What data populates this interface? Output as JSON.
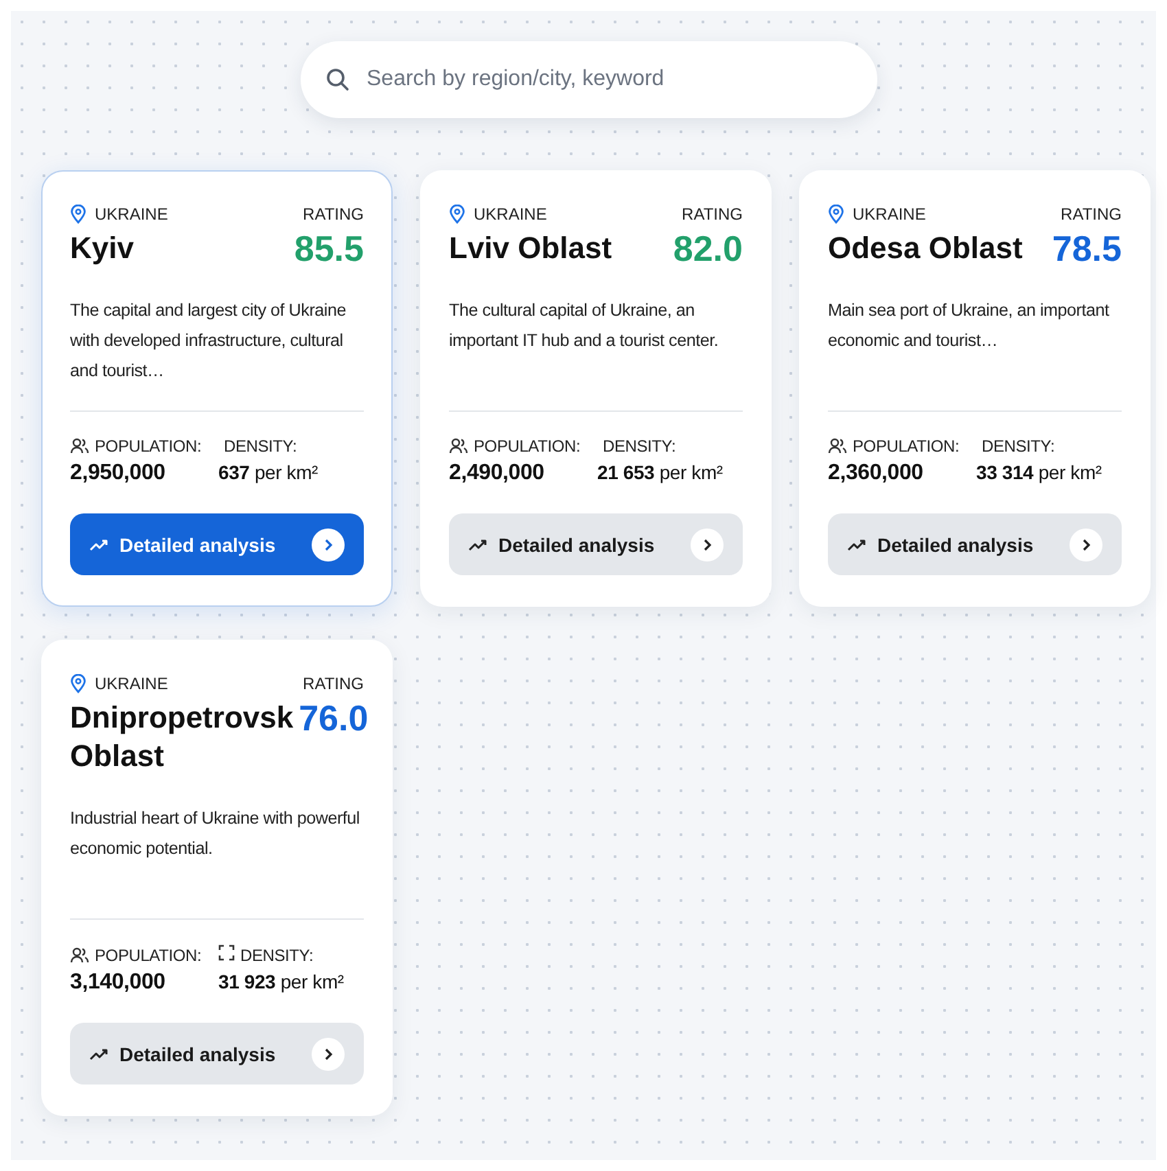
{
  "search": {
    "placeholder": "Search by region/city, keyword"
  },
  "regions": [
    {
      "country": "UKRAINE",
      "rating_label": "RATING",
      "name": "Kyiv",
      "rating": "85.5",
      "color": "#22a06b",
      "description": "The capital and largest city of Ukraine with developed infrastructure, cultural and tourist…",
      "population_label": "POPULATION:",
      "population": "2,950,000",
      "density_label": "DENSITY:",
      "density": "**637** per km²",
      "density_icon": false,
      "button": "Detailed analysis",
      "selected": true
    },
    {
      "country": "UKRAINE",
      "rating_label": "RATING",
      "name": "Lviv Oblast",
      "rating": "82.0",
      "color": "#22a06b",
      "description": "The cultural capital of Ukraine, an important IT hub and a tourist center.",
      "population_label": "POPULATION:",
      "population": "2,490,000",
      "density_label": "DENSITY:",
      "density": "**21 653** per km²",
      "density_icon": false,
      "button": "Detailed analysis",
      "selected": false
    },
    {
      "country": "UKRAINE",
      "rating_label": "RATING",
      "name": "Odesa Oblast",
      "rating": "78.5",
      "color": "#1565d8",
      "description": "Main sea port of Ukraine, an important economic and tourist…",
      "population_label": "POPULATION:",
      "population": "2,360,000",
      "density_label": "DENSITY:",
      "density": "**33 314** per km²",
      "density_icon": false,
      "button": "Detailed analysis",
      "selected": false
    },
    {
      "country": "UKRAINE",
      "rating_label": "RATING",
      "name": "Dnipropetrovsk Oblast",
      "rating": "76.0",
      "color": "#1565d8",
      "description": "Industrial heart of Ukraine with powerful economic potential.",
      "population_label": "POPULATION:",
      "population": "3,140,000",
      "density_label": "DENSITY:",
      "density": "**31 923** per km²",
      "density_icon": true,
      "button": "Detailed analysis",
      "selected": false
    }
  ]
}
